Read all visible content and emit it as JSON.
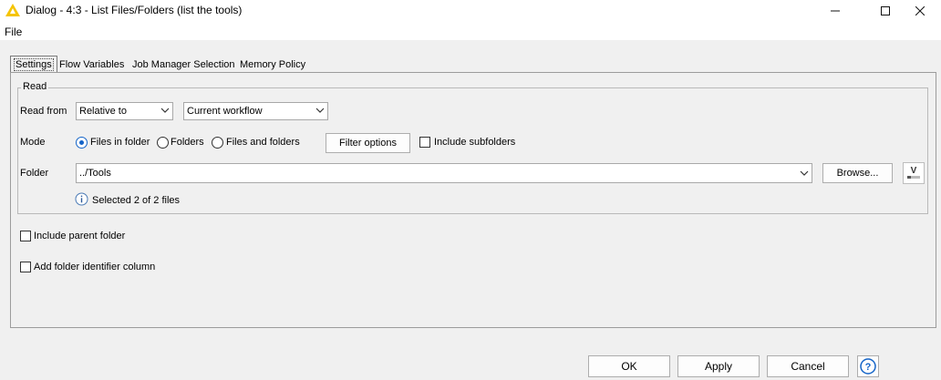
{
  "window": {
    "title": "Dialog - 4:3 - List Files/Folders (list the tools)",
    "minimize_icon": "minimize-icon",
    "maximize_icon": "maximize-icon",
    "close_icon": "close-icon"
  },
  "menu": {
    "file": "File"
  },
  "tabs": [
    {
      "label": "Settings",
      "active": true
    },
    {
      "label": "Flow Variables",
      "active": false
    },
    {
      "label": "Job Manager Selection",
      "active": false
    },
    {
      "label": "Memory Policy",
      "active": false
    }
  ],
  "read": {
    "group_label": "Read",
    "read_from_label": "Read from",
    "read_from_value": "Relative to",
    "relative_value": "Current workflow",
    "mode_label": "Mode",
    "mode_options": [
      "Files in folder",
      "Folders",
      "Files and folders"
    ],
    "mode_selected": "Files in folder",
    "filter_button": "Filter options",
    "include_subfolders": "Include subfolders",
    "folder_label": "Folder",
    "folder_value": "../Tools",
    "browse_button": "Browse...",
    "status": "Selected 2 of 2 files"
  },
  "options": {
    "include_parent": "Include parent folder",
    "add_identifier": "Add folder identifier column"
  },
  "buttons": {
    "ok": "OK",
    "apply": "Apply",
    "cancel": "Cancel"
  },
  "colors": {
    "accent": "#1464c8",
    "knime_yellow": "#f5c400"
  }
}
